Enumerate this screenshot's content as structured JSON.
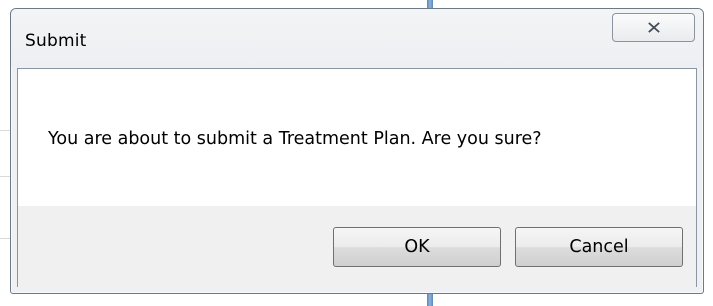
{
  "dialog": {
    "title": "Submit",
    "message": "You are about to submit a Treatment Plan. Are you sure?",
    "ok_label": "OK",
    "cancel_label": "Cancel",
    "close_icon": "close-x-icon"
  },
  "colors": {
    "window_border": "#6d7a86",
    "titlebar_bg": "#f3f4f6",
    "content_bg": "#ffffff",
    "button_area_bg": "#f0f0f0",
    "background_bar": "#5a86b8"
  }
}
